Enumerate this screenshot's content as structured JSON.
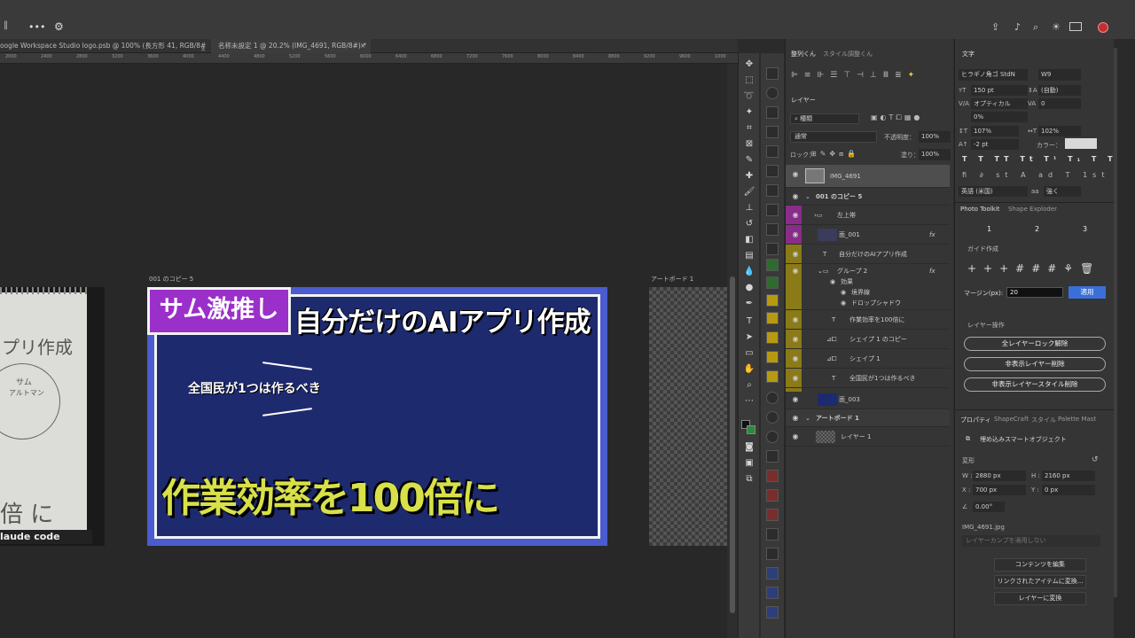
{
  "tabs": [
    {
      "label": "oogle Workspace Studio logo.psb @ 100% (長方形 41, RGB/8#) *"
    },
    {
      "label": "名称未設定 1 @ 20.2% (IMG_4691, RGB/8#) *"
    }
  ],
  "ruler": {
    "ticks": [
      "2000",
      "2400",
      "2800",
      "3200",
      "3600",
      "4000",
      "4400",
      "4800",
      "5200",
      "5600",
      "6000",
      "6400",
      "6800",
      "7200",
      "7600",
      "8000",
      "8400",
      "8800",
      "9200",
      "9600",
      "1000"
    ]
  },
  "canvas": {
    "artboard1_label": "001 のコピー 5",
    "artboard2_label": "アートボード 1",
    "thumb": {
      "badge": "サム激推し",
      "headline": "自分だけのAIアプリ作成",
      "sub": "全国民が1つは作るべき",
      "big": "作業効率を100倍に"
    },
    "sketch": {
      "line1": "プリ作成",
      "line2": "サム",
      "line3": "アルトマン",
      "line4": "倍 に",
      "footer": "laude code"
    }
  },
  "layers_panel": {
    "tab1": "整列くん",
    "tab2": "スタイル調整くん",
    "section": "レイヤー",
    "kind": "種類",
    "blend": "通常",
    "opacity_label": "不透明度：",
    "opacity": "100%",
    "lock_label": "ロック：",
    "fill_label": "塗り：",
    "fill": "100%",
    "rows": [
      {
        "name": "IMG_4691"
      },
      {
        "name": "001 のコピー 5"
      },
      {
        "name": "左上帯"
      },
      {
        "name": "面_001"
      },
      {
        "name": "自分だけのAIアプリ作成"
      },
      {
        "name": "グループ 2"
      },
      {
        "name": "効果"
      },
      {
        "name": "境界線"
      },
      {
        "name": "ドロップシャドウ"
      },
      {
        "name": "作業効率を100倍に"
      },
      {
        "name": "シェイプ 1 のコピー"
      },
      {
        "name": "シェイプ 1"
      },
      {
        "name": "全国民が1つは作るべき"
      },
      {
        "name": "面_003"
      },
      {
        "name": "アートボード 1"
      },
      {
        "name": "レイヤー 1"
      }
    ]
  },
  "char_panel": {
    "title": "文字",
    "font": "ヒラギノ角ゴ StdN",
    "weight": "W9",
    "size": "150 pt",
    "leading": "(自動)",
    "kerning": "オプティカル",
    "tracking": "0",
    "tsume": "0%",
    "vscale": "107%",
    "hscale": "102%",
    "baseline": "-2 pt",
    "color_label": "カラー：",
    "lang": "英語 (米国)",
    "aa": "強く"
  },
  "photo_toolkit": {
    "tab1": "Photo Toolkit",
    "tab2": "Shape Exploder",
    "nums": [
      "1",
      "2",
      "3"
    ],
    "guide": "ガイド作成",
    "margin_label": "マージン(px):",
    "margin_value": "20",
    "apply": "適用",
    "layer_ops": "レイヤー操作",
    "btn1": "全レイヤーロック解除",
    "btn2": "非表示レイヤー削除",
    "btn3": "非表示レイヤースタイル削除"
  },
  "properties": {
    "tabs": [
      "プロパティ",
      "ShapeCraft",
      "スタイル",
      "Palette Mast"
    ],
    "type": "埋め込みスマートオブジェクト",
    "transform": "変形",
    "w": "2880 px",
    "h": "2160 px",
    "x": "700 px",
    "y": "0 px",
    "angle": "0.00°",
    "file": "IMG_4691.jpg",
    "comp": "レイヤーカンプを適用しない",
    "b1": "コンテンツを編集",
    "b2": "リンクされたアイテムに変換...",
    "b3": "レイヤーに変換"
  },
  "colors": {
    "accent": "#3a6fd8",
    "thumb_bg": "#1e2a6e",
    "thumb_border": "#4a5ccf",
    "badge": "#9b2fc9",
    "yellow": "#d8e04a"
  }
}
